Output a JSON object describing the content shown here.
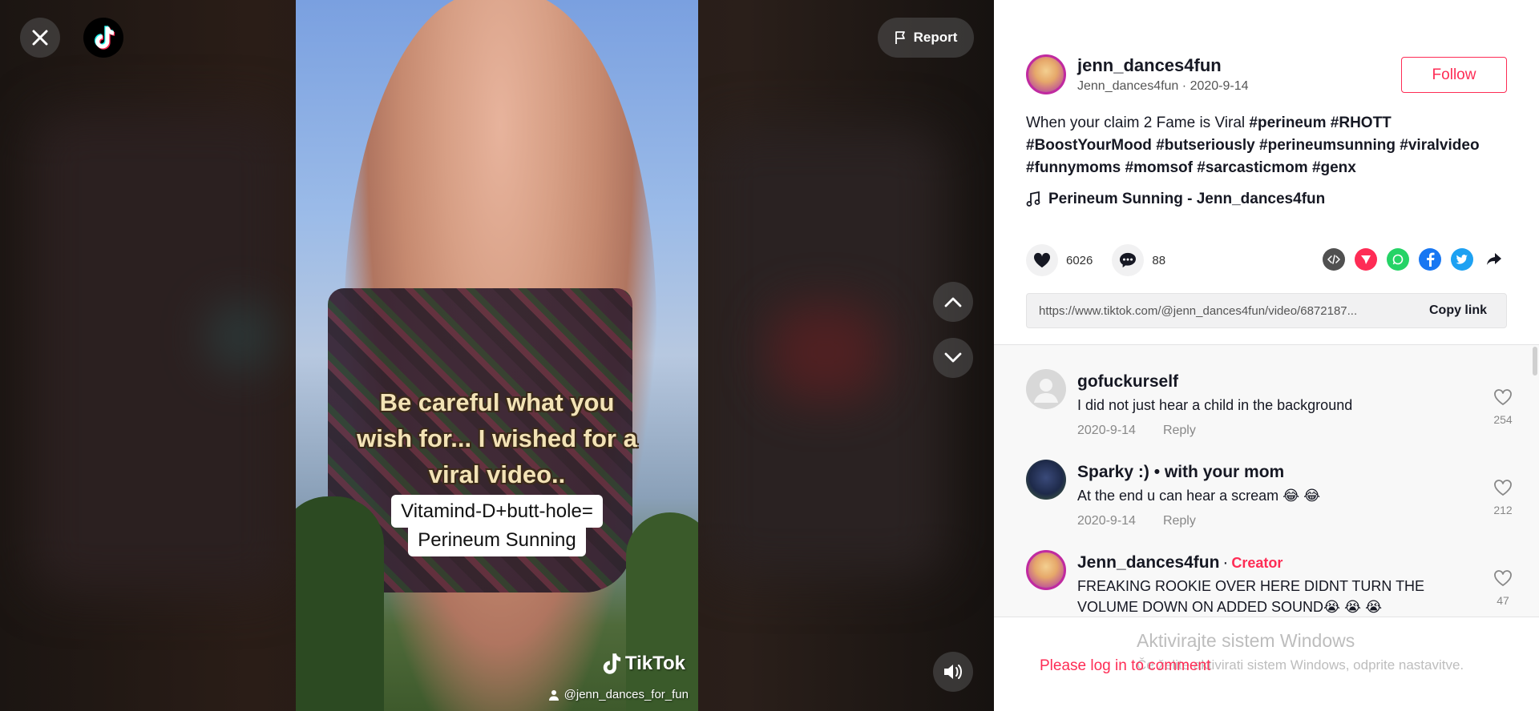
{
  "top": {
    "report_label": "Report"
  },
  "video": {
    "caption_lines": [
      "Be careful what you",
      "wish for... I wished for a",
      "viral video.."
    ],
    "box_lines": [
      "Vitamind-D+butt-hole=",
      "Perineum Sunning"
    ],
    "watermark": "TikTok",
    "watermark_user": "@jenn_dances_for_fun"
  },
  "author": {
    "username": "jenn_dances4fun",
    "display_name": "Jenn_dances4fun",
    "date": "2020-9-14",
    "follow_label": "Follow"
  },
  "description": {
    "text": "When your claim 2 Fame is Viral ",
    "hashtags": [
      "#perineum",
      "#RHOTT",
      "#BoostYourMood",
      "#butseriously",
      "#perineumsunning",
      "#viralvideo",
      "#funnymoms",
      "#momsof",
      "#sarcasticmom",
      "#genx"
    ]
  },
  "music": {
    "title": "Perineum Sunning - Jenn_dances4fun"
  },
  "stats": {
    "likes": "6026",
    "comments": "88"
  },
  "share": {
    "link_url": "https://www.tiktok.com/@jenn_dances4fun/video/6872187...",
    "copy_label": "Copy link"
  },
  "comments": [
    {
      "name": "gofuckurself",
      "text": "I did not just hear a child in the background",
      "date": "2020-9-14",
      "reply": "Reply",
      "likes": "254"
    },
    {
      "name": "Sparky :) • with your mom",
      "text": "At the end u can hear a scream 😂 😂",
      "date": "2020-9-14",
      "reply": "Reply",
      "likes": "212"
    },
    {
      "name": "Jenn_dances4fun",
      "creator_label": "Creator",
      "text": "FREAKING ROOKIE OVER HERE DIDNT TURN THE VOLUME DOWN ON ADDED SOUND😭 😭 😭",
      "likes": "47"
    }
  ],
  "login": {
    "text": "Please log in to comment"
  },
  "windows": {
    "title": "Aktivirajte sistem Windows",
    "subtitle": "Če želite aktivirati sistem Windows, odprite nastavitve."
  },
  "colors": {
    "accent": "#fe2c55",
    "text": "#161823"
  }
}
